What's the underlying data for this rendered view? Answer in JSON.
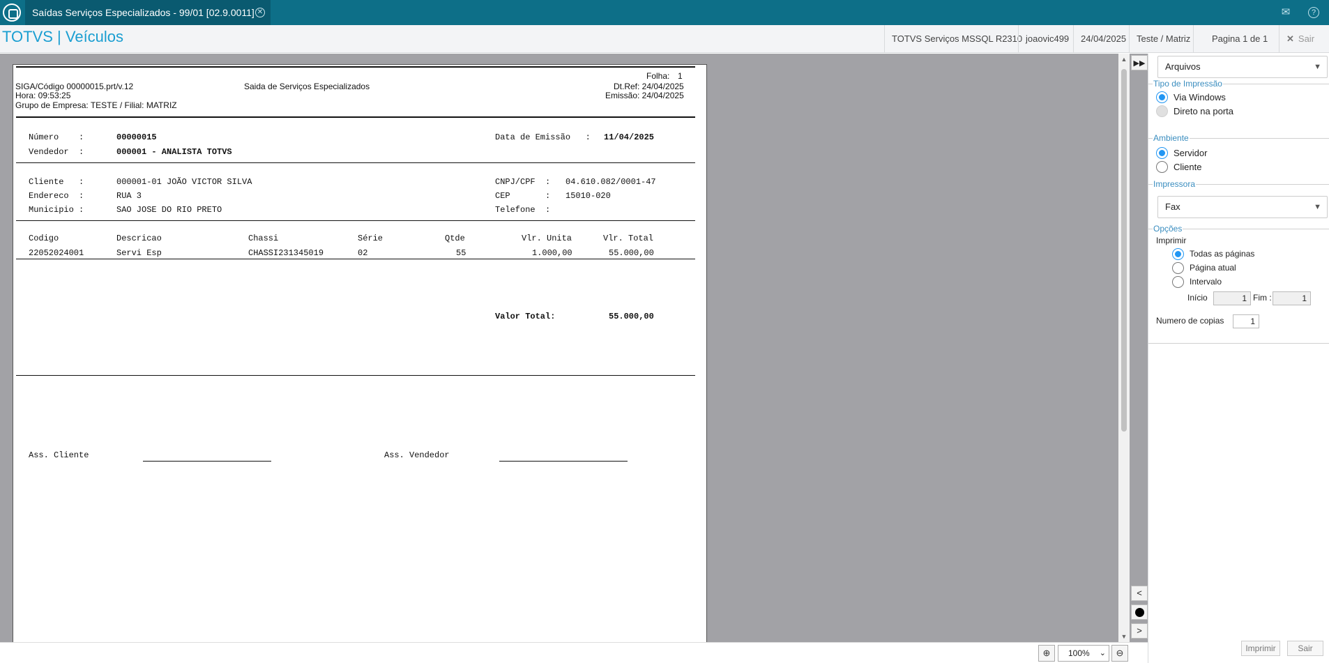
{
  "titlebar": {
    "tab_title": "Saídas Serviços Especializados - 99/01 [02.9.0011]",
    "tab_close_icon": "close-circle-icon",
    "mail_icon": "mail-icon",
    "help_icon": "help-icon"
  },
  "header": {
    "module_title": "TOTVS | Veículos",
    "environment": "TOTVS Serviços MSSQL R2310",
    "user": "joaovic499",
    "date": "24/04/2025",
    "branch": "Teste / Matriz",
    "page_info": "Pagina 1 de 1",
    "exit_label": "Sair"
  },
  "report": {
    "folha_label": "Folha:",
    "folha_value": "1",
    "program": "SIGA/Código 00000015.prt/v.12",
    "title": "Saida de Serviços Especializados",
    "dtref": "Dt.Ref: 24/04/2025",
    "hora": "Hora: 09:53:25",
    "emissao": "Emissão: 24/04/2025",
    "grupo": "Grupo de Empresa: TESTE / Filial: MATRIZ",
    "numero_label": "Número    :",
    "numero_value": "00000015",
    "data_emissao_label": "Data de Emissão   :",
    "data_emissao_value": "11/04/2025",
    "vendedor_label": "Vendedor  :",
    "vendedor_value": "000001 - ANALISTA TOTVS",
    "cliente_label": "Cliente   :",
    "cliente_value": "000001-01 JOÃO VICTOR SILVA",
    "cnpj_label": "CNPJ/CPF  :",
    "cnpj_value": "04.610.082/0001-47",
    "endereco_label": "Endereco  :",
    "endereco_value": "RUA 3",
    "cep_label": "CEP       :",
    "cep_value": "15010-020",
    "municipio_label": "Municipio :",
    "municipio_value": "SAO JOSE DO RIO PRETO",
    "telefone_label": "Telefone  :",
    "columns": {
      "codigo": "Codigo",
      "descricao": "Descricao",
      "chassi": "Chassi",
      "serie": "Série",
      "qtde": "Qtde",
      "vlr_unita": "Vlr. Unita",
      "vlr_total": "Vlr. Total"
    },
    "item": {
      "codigo": "22052024001",
      "descricao": "Servi Esp",
      "chassi": "CHASSI231345019",
      "serie": "02",
      "qtde": "55",
      "vlr_unita": "1.000,00",
      "vlr_total": "55.000,00"
    },
    "valor_total_label": "Valor Total:",
    "valor_total_value": "55.000,00",
    "ass_cliente": "Ass. Cliente",
    "ass_vendedor": "Ass. Vendedor"
  },
  "preview_nav": {
    "forward_icon": "fast-forward-icon",
    "prev_icon": "chevron-left-icon",
    "stop_icon": "stop-icon",
    "next_icon": "chevron-right-icon"
  },
  "zoom": {
    "value": "100%",
    "zoom_in_icon": "zoom-in-icon",
    "zoom_out_icon": "zoom-out-icon"
  },
  "options": {
    "destination": "Arquivos",
    "tipo_impressao_legend": "Tipo de Impressão",
    "via_windows": "Via Windows",
    "direto_porta": "Direto na porta",
    "ambiente_legend": "Ambiente",
    "servidor": "Servidor",
    "cliente": "Cliente",
    "impressora_legend": "Impressora",
    "impressora_value": "Fax",
    "opcoes_legend": "Opções",
    "imprimir_label": "Imprimir",
    "todas_paginas": "Todas as páginas",
    "pagina_atual": "Página atual",
    "intervalo": "Intervalo",
    "inicio_label": "Início",
    "inicio_value": "1",
    "fim_label": "Fim :",
    "fim_value": "1",
    "copias_label": "Numero de copias",
    "copias_value": "1",
    "imprimir_button": "Imprimir",
    "sair_button": "Sair"
  }
}
